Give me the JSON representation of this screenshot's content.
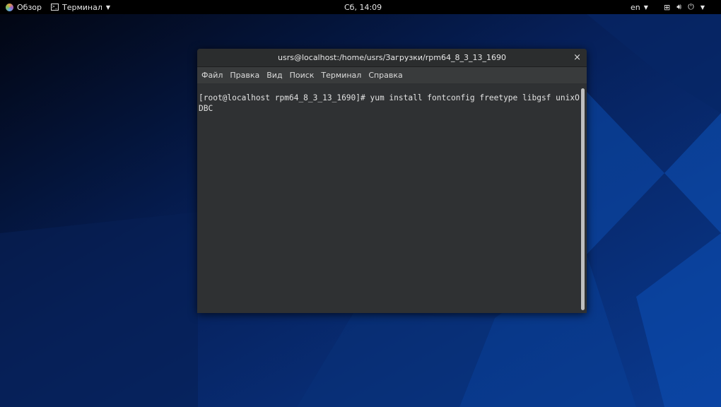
{
  "topbar": {
    "overview": "Обзор",
    "app_menu": "Терминал",
    "clock": "Сб, 14:09",
    "language": "en"
  },
  "window": {
    "title": "usrs@localhost:/home/usrs/Загрузки/rpm64_8_3_13_1690",
    "close": "×",
    "menu": [
      "Файл",
      "Правка",
      "Вид",
      "Поиск",
      "Терминал",
      "Справка"
    ],
    "terminal_lines": [
      "[root@localhost rpm64_8_3_13_1690]# yum install fontconfig freetype libgsf unixO",
      "DBC"
    ]
  }
}
